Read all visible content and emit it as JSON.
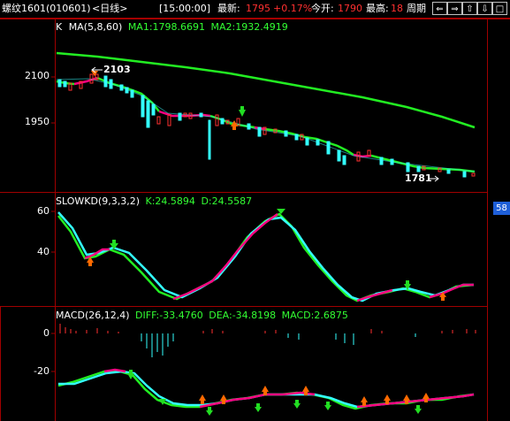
{
  "header": {
    "symbol": "螺纹1601",
    "code": "(010601)",
    "period": "<日线>",
    "time": "[15:00:00]",
    "last_label": "最新:",
    "last_value": "1795",
    "change": "+0.17%",
    "open_label": "今开:",
    "open_value": "1790",
    "high_label": "最高:",
    "high_value": "18",
    "period_button": "周期"
  },
  "toolbar_icons": [
    "back-icon",
    "forward-icon",
    "zoom-in-icon",
    "zoom-out-icon",
    "expand-icon"
  ],
  "main": {
    "indicator_label": "K",
    "ma_label": "MA(5,8,60)",
    "ma1_text": "MA1:1798.6691",
    "ma2_text": "MA2:1932.4919",
    "y_ticks": [
      "2100",
      "1950"
    ],
    "annot_high": "2103",
    "annot_low": "1781"
  },
  "kd": {
    "label": "SLOWKD(9,3,3,2)",
    "k_text": "K:24.5894",
    "d_text": "D:24.5587",
    "y_ticks": [
      "60",
      "40"
    ],
    "value_box": "58"
  },
  "macd": {
    "label": "MACD(26,12,4)",
    "diff_text": "DIFF:-33.4760",
    "dea_text": "DEA:-34.8198",
    "macd_text": "MACD:2.6875",
    "y_ticks": [
      "0",
      "-20"
    ]
  },
  "colors": {
    "ma_green": "#22ee22",
    "ma_magenta": "#ff0080",
    "cyan": "#33ffff",
    "up": "#ff3030",
    "label_green": "#33ff33",
    "white": "#ffffff",
    "red_text": "#ff3030"
  }
}
